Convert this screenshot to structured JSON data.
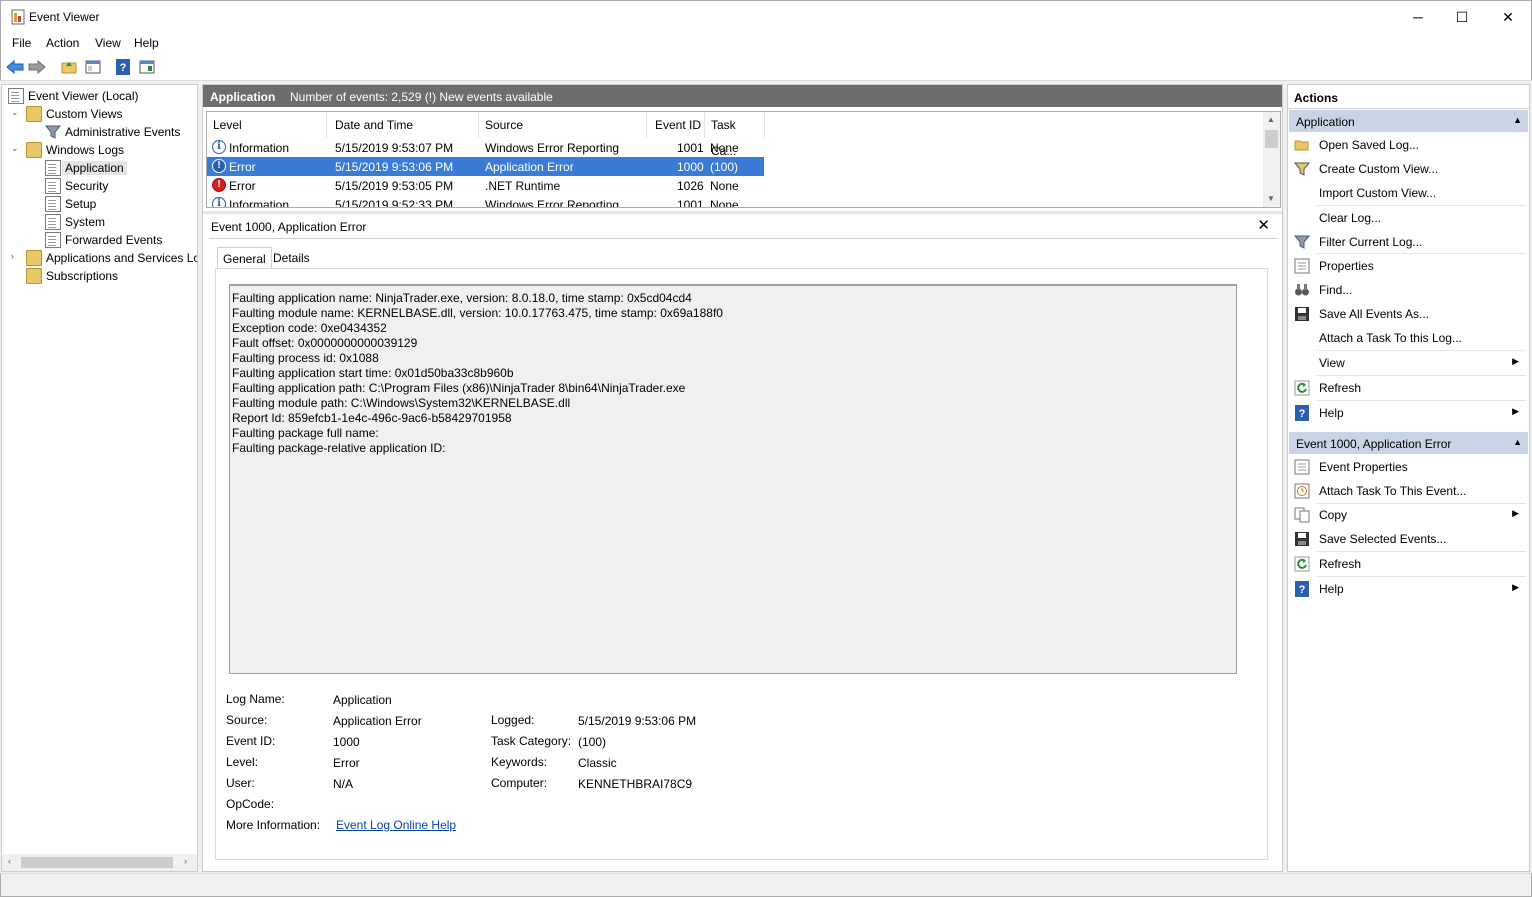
{
  "window": {
    "title": "Event Viewer",
    "minimize": "─",
    "maximize": "☐",
    "close": "✕"
  },
  "menu": [
    "File",
    "Action",
    "View",
    "Help"
  ],
  "tree": {
    "root": "Event Viewer (Local)",
    "custom_views": "Custom Views",
    "administrative_events": "Administrative Events",
    "windows_logs": "Windows Logs",
    "application": "Application",
    "security": "Security",
    "setup": "Setup",
    "system": "System",
    "forwarded_events": "Forwarded Events",
    "apps_services": "Applications and Services Logs",
    "subscriptions": "Subscriptions"
  },
  "center": {
    "log_name": "Application",
    "event_count": "Number of events: 2,529 (!) New events available",
    "columns": [
      "Level",
      "Date and Time",
      "Source",
      "Event ID",
      "Task Ca..."
    ],
    "rows": [
      {
        "level": "Information",
        "date": "5/15/2019 9:53:07 PM",
        "source": "Windows Error Reporting",
        "id": "1001",
        "task": "None"
      },
      {
        "level": "Error",
        "date": "5/15/2019 9:53:06 PM",
        "source": "Application Error",
        "id": "1000",
        "task": "(100)"
      },
      {
        "level": "Error",
        "date": "5/15/2019 9:53:05 PM",
        "source": ".NET Runtime",
        "id": "1026",
        "task": "None"
      },
      {
        "level": "Information",
        "date": "5/15/2019 9:52:33 PM",
        "source": "Windows Error Reporting",
        "id": "1001",
        "task": "None"
      }
    ]
  },
  "detail": {
    "title": "Event 1000, Application Error",
    "close": "✕",
    "tab_general": "General",
    "tab_details": "Details",
    "description": "Faulting application name: NinjaTrader.exe, version: 8.0.18.0, time stamp: 0x5cd04cd4\nFaulting module name: KERNELBASE.dll, version: 10.0.17763.475, time stamp: 0x69a188f0\nException code: 0xe0434352\nFault offset: 0x0000000000039129\nFaulting process id: 0x1088\nFaulting application start time: 0x01d50ba33c8b960b\nFaulting application path: C:\\Program Files (x86)\\NinjaTrader 8\\bin64\\NinjaTrader.exe\nFaulting module path: C:\\Windows\\System32\\KERNELBASE.dll\nReport Id: 859efcb1-1e4c-496c-9ac6-b58429701958\nFaulting package full name: \nFaulting package-relative application ID: ",
    "labels": {
      "log_name": "Log Name:",
      "source": "Source:",
      "event_id": "Event ID:",
      "level": "Level:",
      "user": "User:",
      "opcode": "OpCode:",
      "more_info": "More Information:",
      "logged": "Logged:",
      "task_category": "Task Category:",
      "keywords": "Keywords:",
      "computer": "Computer:"
    },
    "values": {
      "log_name": "Application",
      "source": "Application Error",
      "event_id": "1000",
      "level": "Error",
      "user": "N/A",
      "opcode": "",
      "more_info": "Event Log Online Help",
      "logged": "5/15/2019 9:53:06 PM",
      "task_category": "(100)",
      "keywords": "Classic",
      "computer": "KENNETHBRAI78C9"
    }
  },
  "actions": {
    "header": "Actions",
    "group1": "Application",
    "group1_items": [
      "Open Saved Log...",
      "Create Custom View...",
      "Import Custom View...",
      "Clear Log...",
      "Filter Current Log...",
      "Properties",
      "Find...",
      "Save All Events As...",
      "Attach a Task To this Log...",
      "View",
      "Refresh",
      "Help"
    ],
    "group2": "Event 1000, Application Error",
    "group2_items": [
      "Event Properties",
      "Attach Task To This Event...",
      "Copy",
      "Save Selected Events...",
      "Refresh",
      "Help"
    ]
  },
  "colors": {
    "selection": "#3a7bd5",
    "header_bg": "#6d6d6d",
    "group_bg": "#c9d5e6",
    "link": "#0645ad"
  }
}
